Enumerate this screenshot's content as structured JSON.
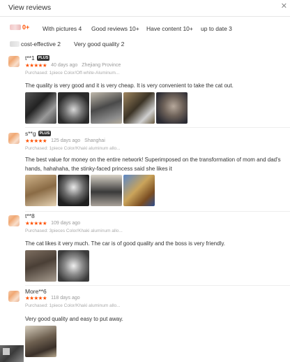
{
  "header": {
    "title": "View reviews",
    "close_icon": "close-icon"
  },
  "filters": [
    {
      "label": "0+",
      "selected": true
    },
    {
      "label": "With pictures 4"
    },
    {
      "label": "Good reviews 10+"
    },
    {
      "label": "Have content 10+"
    },
    {
      "label": "up to date 3"
    },
    {
      "label": "cost-effective 2"
    },
    {
      "label": "Very good quality 2"
    }
  ],
  "reviews": [
    {
      "user": "t**1",
      "badge": "PLUS",
      "stars": "★★★★★",
      "days": "40 days ago",
      "location": "Zhejiang Province",
      "purchased": "Purchased: 1piece Color/Off-white-Aluminum...",
      "text": "The quality is very good and it is very cheap. It is very convenient to take the cat out.",
      "photos": 5
    },
    {
      "user": "s**g",
      "badge": "PLUS",
      "stars": "★★★★★",
      "days": "125 days ago",
      "location": "Shanghai",
      "purchased": "Purchased: 1piece Color/Khaki aluminum allo...",
      "text": "The best value for money on the entire network! Superimposed on the transformation of mom and dad's hands, hahahaha, the stinky-faced princess said she likes it",
      "photos": 4
    },
    {
      "user": "t**8",
      "stars": "★★★★★",
      "days": "109 days ago",
      "purchased": "Purchased: 3pieces Color/Khaki aluminum allo...",
      "text": "The cat likes it very much. The car is of good quality and the boss is very friendly.",
      "photos": 2
    },
    {
      "user": "More**6",
      "stars": "★★★★★",
      "days": "118 days ago",
      "purchased": "Purchased: 1piece Color/Khaki aluminum allo...",
      "text": "Very good quality and easy to put away.",
      "photos": 1
    }
  ],
  "colors": {
    "accent": "#ff5000",
    "text": "#333333",
    "muted": "#999999"
  }
}
